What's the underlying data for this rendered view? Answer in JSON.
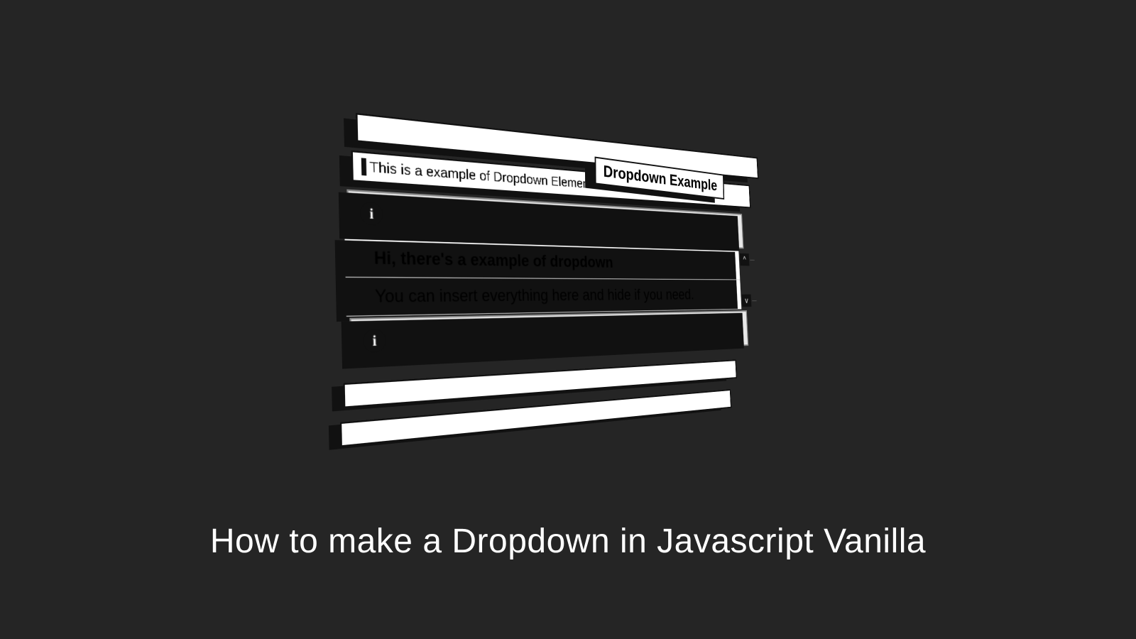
{
  "caption": "How to make a Dropdown in Javascript Vanilla",
  "panel": {
    "title": "Dropdown Example",
    "description": "This is a example of Dropdown Elements in JavaScript vanilla",
    "expanded": {
      "heading": "Hi, there's a example of dropdown",
      "body": "You can insert everything here and hide if you need."
    },
    "icons": {
      "info": "i",
      "collapse": "^",
      "expand": "v"
    }
  }
}
